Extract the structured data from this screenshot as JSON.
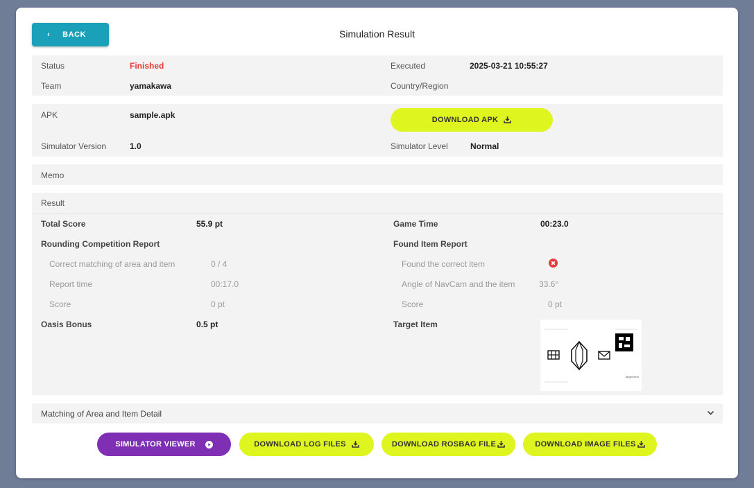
{
  "header": {
    "back_label": "BACK",
    "title": "Simulation Result"
  },
  "info": {
    "status_label": "Status",
    "status_value": "Finished",
    "executed_label": "Executed",
    "executed_value": "2025-03-21 10:55:27",
    "team_label": "Team",
    "team_value": "yamakawa",
    "country_label": "Country/Region",
    "country_value": ""
  },
  "apk": {
    "apk_label": "APK",
    "apk_value": "sample.apk",
    "download_label": "DOWNLOAD APK",
    "sim_version_label": "Simulator Version",
    "sim_version_value": "1.0",
    "sim_level_label": "Simulator Level",
    "sim_level_value": "Normal"
  },
  "memo": {
    "label": "Memo"
  },
  "result": {
    "label": "Result",
    "total_score_label": "Total Score",
    "total_score_value": "55.9 pt",
    "game_time_label": "Game Time",
    "game_time_value": "00:23.0",
    "rounding_report_label": "Rounding Competition Report",
    "found_item_report_label": "Found Item Report",
    "correct_matching_label": "Correct matching of area and item",
    "correct_matching_value": "0 / 4",
    "report_time_label": "Report time",
    "report_time_value": "00:17.0",
    "rounding_score_label": "Score",
    "rounding_score_value": "0 pt",
    "found_correct_label": "Found the correct item",
    "angle_label": "Angle of NavCam and the item",
    "angle_value": "33.6°",
    "found_score_label": "Score",
    "found_score_value": "0 pt",
    "oasis_label": "Oasis Bonus",
    "oasis_value": "0.5 pt",
    "target_item_label": "Target Item",
    "target_image_caption": "Target Item"
  },
  "matching": {
    "label": "Matching of Area and Item Detail"
  },
  "actions": {
    "viewer": "SIMULATOR VIEWER",
    "log": "DOWNLOAD LOG FILES",
    "rosbag": "DOWNLOAD ROSBAG FILE",
    "image": "DOWNLOAD IMAGE FILES"
  },
  "colors": {
    "accent_teal": "#1aa0b8",
    "lime": "#dff51f",
    "purple": "#7e2fb3",
    "status_red": "#e53935"
  },
  "icons": {
    "back": "chevron-left-icon",
    "download": "download-icon",
    "viewer": "play-circle-icon",
    "fail": "error-circle-icon",
    "expand": "chevron-down-icon"
  }
}
